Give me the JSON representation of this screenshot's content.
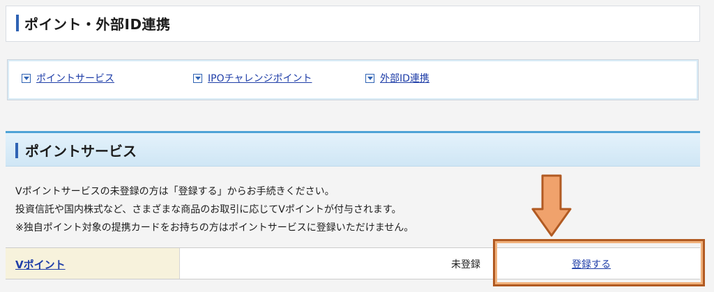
{
  "page": {
    "title": "ポイント・外部ID連携"
  },
  "nav": {
    "items": [
      {
        "label": "ポイントサービス"
      },
      {
        "label": "IPOチャレンジポイント"
      },
      {
        "label": "外部ID連携"
      }
    ]
  },
  "section": {
    "title": "ポイントサービス",
    "info_lines": [
      "Vポイントサービスの未登録の方は「登録する」からお手続きください。",
      "投資信託や国内株式など、さまざまな商品のお取引に応じてVポイントが付与されます。",
      "※独自ポイント対象の提携カードをお持ちの方はポイントサービスに登録いただけません。"
    ]
  },
  "row": {
    "label": "Vポイント",
    "status": "未登録",
    "action": "登録する"
  },
  "colors": {
    "accent_blue": "#2f63b4",
    "link_blue": "#1f3ea8",
    "highlight_orange": "#e8904f"
  },
  "icons": [
    "dropdown-square-icon",
    "down-arrow-icon"
  ]
}
